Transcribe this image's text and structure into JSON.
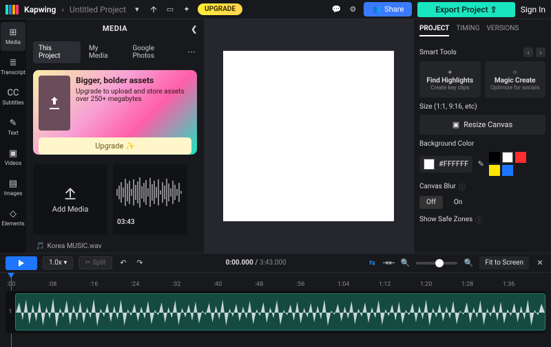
{
  "header": {
    "brand": "Kapwing",
    "crumb_sep": "›",
    "project_name": "Untitled Project",
    "upgrade": "UPGRADE",
    "share": "Share",
    "export": "Export Project",
    "signin": "Sign In"
  },
  "rail": [
    {
      "label": "Media",
      "icon": "⊞",
      "active": true
    },
    {
      "label": "Transcript",
      "icon": "≣"
    },
    {
      "label": "Subtitles",
      "icon": "CC"
    },
    {
      "label": "Text",
      "icon": "✎"
    },
    {
      "label": "Videos",
      "icon": "▣"
    },
    {
      "label": "Images",
      "icon": "▤"
    },
    {
      "label": "Elements",
      "icon": "◇"
    }
  ],
  "media": {
    "title": "MEDIA",
    "tabs": [
      "This Project",
      "My Media",
      "Google Photos"
    ],
    "active_tab": 0,
    "promo": {
      "title": "Bigger, bolder assets",
      "body": "Upgrade to upload and store assets over 250+ megabytes",
      "cta": "Upgrade ✨"
    },
    "add_media": "Add Media",
    "asset": {
      "duration": "03:43",
      "filename": "Korea MUSIC.wav"
    }
  },
  "right": {
    "tabs": [
      "PROJECT",
      "TIMING",
      "VERSIONS"
    ],
    "active_tab": 0,
    "smart_title": "Smart Tools",
    "smart": [
      {
        "t": "Find Highlights",
        "s": "Create key clips",
        "icon": "✦"
      },
      {
        "t": "Magic Create",
        "s": "Optimize for socials",
        "icon": "✧"
      }
    ],
    "size_label": "Size (1:1, 9:16, etc)",
    "resize": "Resize Canvas",
    "bg_label": "Background Color",
    "hex": "#FFFFFF",
    "swatches": [
      "#000000",
      "#ffffff",
      "#ff2d2d",
      "#ffe600",
      "#1e75ff"
    ],
    "blur_label": "Canvas Blur",
    "blur_off": "Off",
    "blur_on": "On",
    "safe_label": "Show Safe Zones"
  },
  "timeline": {
    "rate": "1.0x",
    "split": "✂ Split",
    "time_current": "0:00.000",
    "time_total": "3:43.000",
    "fit": "Fit to Screen",
    "ticks": [
      ":00",
      ":08",
      ":16",
      ":24",
      ":32",
      ":40",
      ":48",
      ":56",
      "1:04",
      "1:12",
      "1:20",
      "1:28",
      "1:36"
    ],
    "track_label": "1"
  }
}
